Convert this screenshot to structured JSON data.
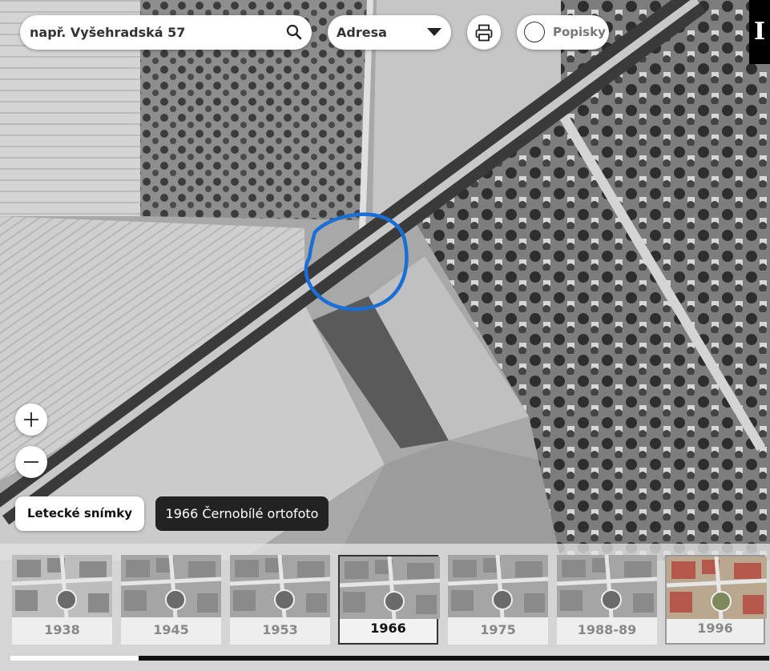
{
  "search": {
    "placeholder": "např. Vyšehradská 57",
    "icon": "search-icon"
  },
  "address_select": {
    "selected": "Adresa",
    "icon": "chevron-down-icon"
  },
  "print": {
    "icon": "printer-icon"
  },
  "labels_toggle": {
    "label": "Popisky",
    "checked": false
  },
  "logo": {
    "text": "I"
  },
  "zoom": {
    "in_symbol": "+",
    "out_symbol": "−"
  },
  "layer": {
    "button_label": "Letecké snímky",
    "current_label": "1966 Černobílé ortofoto"
  },
  "timeline": {
    "items": [
      {
        "year": "1938",
        "active": false,
        "color": false
      },
      {
        "year": "1945",
        "active": false,
        "color": false
      },
      {
        "year": "1953",
        "active": false,
        "color": false
      },
      {
        "year": "1966",
        "active": true,
        "color": false
      },
      {
        "year": "1975",
        "active": false,
        "color": false
      },
      {
        "year": "1988-89",
        "active": false,
        "color": false
      },
      {
        "year": "1996",
        "active": false,
        "color": true
      }
    ],
    "scroll_position": 0.15
  },
  "colors": {
    "highlight_circle": "#1a6fd6",
    "active_thumb_border": "#333333",
    "label_background": "#222222"
  }
}
